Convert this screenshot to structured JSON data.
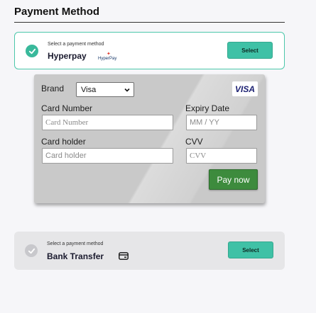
{
  "section_title": "Payment Method",
  "options": [
    {
      "hint": "Select a payment method",
      "name": "Hyperpay",
      "logo_text": "HyperPay",
      "select_label": "Select",
      "selected": true
    },
    {
      "hint": "Select a payment method",
      "name": "Bank Transfer",
      "select_label": "Select",
      "selected": false
    }
  ],
  "card_form": {
    "brand_label": "Brand",
    "brand_value": "Visa",
    "brand_badge": "VISA",
    "card_number_label": "Card Number",
    "card_number_placeholder": "Card Number",
    "expiry_label": "Expiry Date",
    "expiry_placeholder": "MM / YY",
    "holder_label": "Card holder",
    "holder_placeholder": "Card holder",
    "cvv_label": "CVV",
    "cvv_placeholder": "CVV",
    "pay_label": "Pay now"
  },
  "colors": {
    "accent": "#3fc1a6",
    "pay_button": "#3d8b3d",
    "selected_border": "#4cc7aa"
  }
}
